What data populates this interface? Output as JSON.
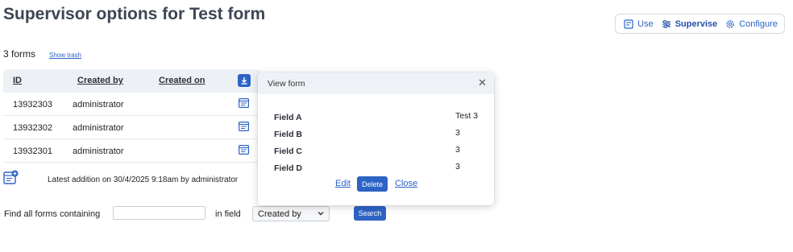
{
  "page": {
    "title": "Supervisor options for Test form"
  },
  "modes": {
    "use": {
      "label": "Use",
      "icon": "form-icon"
    },
    "supervise": {
      "label": "Supervise",
      "icon": "sliders-icon"
    },
    "configure": {
      "label": "Configure",
      "icon": "gear-icon"
    }
  },
  "summary": {
    "count_text": "3 forms",
    "show_trash": "Show trash"
  },
  "table": {
    "headers": {
      "id": "ID",
      "created_by": "Created by",
      "created_on": "Created on"
    },
    "rows": [
      {
        "id": "13932303",
        "created_by": "administrator",
        "created_on": ""
      },
      {
        "id": "13932302",
        "created_by": "administrator",
        "created_on": ""
      },
      {
        "id": "13932301",
        "created_by": "administrator",
        "created_on": ""
      }
    ]
  },
  "latest": {
    "text": "Latest addition on 30/4/2025 9:18am by administrator"
  },
  "search": {
    "label": "Find all forms containing",
    "input_value": "",
    "in_field_label": "in field",
    "field_selected": "Created by",
    "button": "Search"
  },
  "modal": {
    "title": "View form",
    "close_glyph": "✕",
    "fields": [
      {
        "name": "Field A",
        "value": "Test 3"
      },
      {
        "name": "Field B",
        "value": "3"
      },
      {
        "name": "Field C",
        "value": "3"
      },
      {
        "name": "Field D",
        "value": "3"
      }
    ],
    "actions": {
      "edit": "Edit",
      "delete": "Delete",
      "close": "Close"
    }
  },
  "colors": {
    "accent": "#2d63c4",
    "header_bg": "#edf1f6",
    "title": "#3d4654"
  }
}
